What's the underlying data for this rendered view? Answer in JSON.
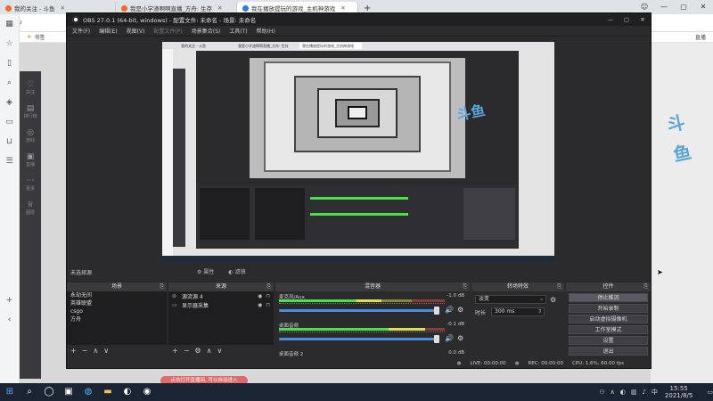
{
  "browser": {
    "tabs": [
      {
        "label": "我的关注 - 斗鱼",
        "active": false
      },
      {
        "label": "我是小学渣啊啊直播_方舟: 生存",
        "active": false
      },
      {
        "label": "我在播放提玩的游戏_主机神游戏",
        "active": true
      }
    ],
    "new_tab": "+",
    "bookmark_label": "书签",
    "right_bookmark": "直播"
  },
  "douyu": {
    "left_items": [
      "关注",
      "排行榜",
      "游戏",
      "直播",
      "更多",
      "圈层"
    ],
    "logo_text": "斗鱼",
    "toast": "点击打开直播间, 可以自动进入"
  },
  "obs": {
    "title": "OBS 27.0.1 (64-bit, windows) - 配置文件: 未命名 - 场景: 未命名",
    "menu": [
      "文件(F)",
      "编辑(E)",
      "视图(V)",
      "配置文件(P)",
      "场景集合(S)",
      "工具(T)",
      "帮助(H)"
    ],
    "no_source_selected": "未选择源",
    "properties_btn": "属性",
    "filters_btn": "滤镜",
    "docks": {
      "scenes": {
        "title": "场景",
        "items": [
          "永劫无间",
          "英雄联盟",
          "csgo",
          "方舟"
        ]
      },
      "sources": {
        "title": "来源",
        "items": [
          {
            "icon": "game-capture-icon",
            "label": "源流源 4"
          },
          {
            "icon": "display-capture-icon",
            "label": "显示器采集"
          }
        ]
      },
      "mixer": {
        "title": "混音器",
        "channels": [
          {
            "name": "麦克风/Aux",
            "db": "-1.0 dB",
            "level": 0.62
          },
          {
            "name": "桌面音频",
            "db": "-0.1 dB",
            "level": 0.88
          },
          {
            "name": "桌面音频 2",
            "db": "0.0 dB",
            "level": 0.0
          }
        ]
      },
      "transitions": {
        "title": "转场特效",
        "type": "淡变",
        "duration_label": "时长",
        "duration_value": "300 ms"
      },
      "controls": {
        "title": "控件",
        "buttons": [
          "停止推流",
          "开始录制",
          "启动虚拟摄像机",
          "工作室模式",
          "设置",
          "退出"
        ]
      }
    },
    "status": {
      "live": "LIVE: 00:00:00",
      "rec": "REC: 00:00:00",
      "cpu": "CPU: 1.6%, 60.00 fps"
    }
  },
  "taskbar": {
    "time": "15:55",
    "date": "2021/8/5",
    "lang": "中"
  }
}
